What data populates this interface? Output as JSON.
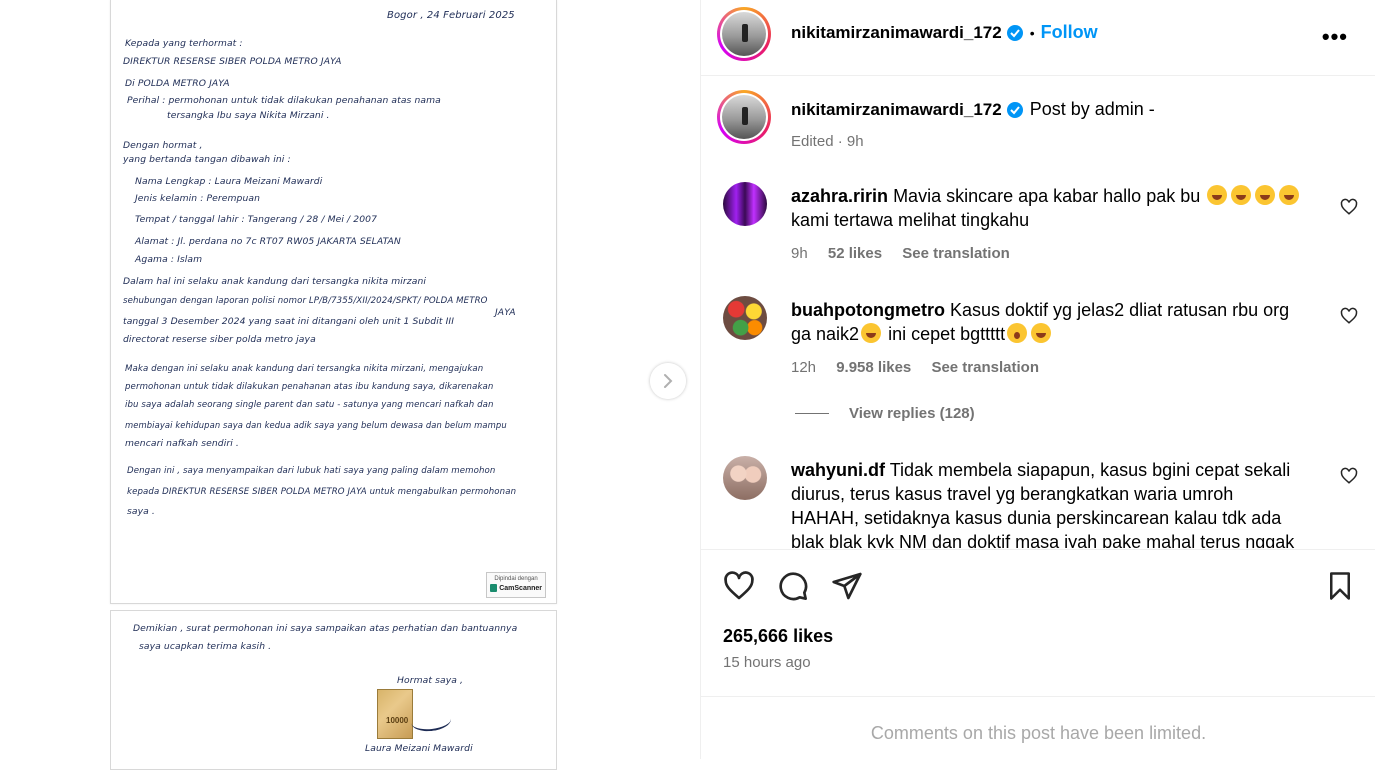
{
  "letter": {
    "date": "Bogor , 24 Februari 2025",
    "lines": [
      "Kepada yang terhormat :",
      "DIREKTUR RESERSE SIBER POLDA METRO JAYA",
      "Di POLDA METRO JAYA",
      "Perihal : permohonan untuk tidak dilakukan penahanan atas nama",
      "tersangka Ibu saya Nikita Mirzani .",
      "Dengan hormat ,",
      "yang bertanda tangan dibawah ini :",
      "Nama Lengkap : Laura Meizani Mawardi",
      "Jenis kelamin : Perempuan",
      "Tempat / tanggal lahir : Tangerang / 28 / Mei / 2007",
      "Alamat : Jl. perdana no 7c RT07 RW05 JAKARTA SELATAN",
      "Agama : Islam",
      "Dalam hal ini selaku anak kandung dari tersangka nikita mirzani",
      "sehubungan dengan laporan polisi nomor LP/B/7355/XII/2024/SPKT/ POLDA METRO",
      "JAYA",
      "tanggal 3 Desember 2024 yang saat ini ditangani oleh unit 1 Subdit III",
      "directorat reserse siber polda metro jaya",
      "Maka dengan ini selaku anak kandung dari tersangka nikita mirzani, mengajukan",
      "permohonan untuk tidak dilakukan penahanan atas ibu kandung saya, dikarenakan",
      "ibu saya adalah seorang single parent dan satu - satunya yang mencari nafkah dan",
      "membiayai kehidupan saya dan kedua adik saya yang belum dewasa dan belum mampu",
      "mencari nafkah sendiri .",
      "Dengan ini , saya menyampaikan dari lubuk hati saya yang paling dalam memohon",
      "kepada DIREKTUR RESERSE SIBER POLDA METRO JAYA untuk mengabulkan permohonan",
      "saya ."
    ],
    "scanner_top": "Dipindai dengan",
    "scanner_brand": "CamScanner",
    "page2_lines": [
      "Demikian , surat permohonan ini saya sampaikan atas perhatian dan bantuannya",
      "saya ucapkan terima kasih .",
      "Hormat saya ,",
      "Laura Meizani Mawardi"
    ],
    "stamp_value": "10000"
  },
  "header": {
    "username": "nikitamirzanimawardi_172",
    "separator": "•",
    "follow_label": "Follow",
    "more_label": "•••"
  },
  "caption": {
    "username": "nikitamirzanimawardi_172",
    "text": "Post by admin -",
    "meta": "Edited · 9h"
  },
  "comments": [
    {
      "username": "azahra.ririn",
      "text": "Mavia skincare apa kabar hallo pak bu",
      "text2": "kami tertawa melihat tingkahu",
      "time": "9h",
      "likes": "52 likes",
      "translate": "See translation"
    },
    {
      "username": "buahpotongmetro",
      "text": "Kasus doktif yg jelas2 dliat ratusan rbu org",
      "text2": "ga naik2",
      "text3": "ini cepet bgttttt",
      "time": "12h",
      "likes": "9.958 likes",
      "translate": "See translation",
      "view_replies": "View replies (128)"
    },
    {
      "username": "wahyuni.df",
      "text": "Tidak membela siapapun, kasus bgini cepat sekali",
      "lines": [
        "diurus, terus kasus travel yg berangkatkan waria umroh",
        "HAHAH, setidaknya kasus dunia perskincarean kalau tdk ada",
        "blak blak kyk NM dan doktif masa iyah pake mahal terus nggak"
      ]
    }
  ],
  "footer": {
    "likes": "265,666 likes",
    "time": "15 hours ago",
    "limited": "Comments on this post have been limited."
  },
  "colors": {
    "accent": "#0095f6",
    "muted": "#737373",
    "limited": "#a8a8a8"
  },
  "icons": [
    "heart-icon",
    "comment-icon",
    "share-icon",
    "bookmark-icon",
    "verified-icon",
    "chevron-right-icon",
    "more-icon"
  ]
}
